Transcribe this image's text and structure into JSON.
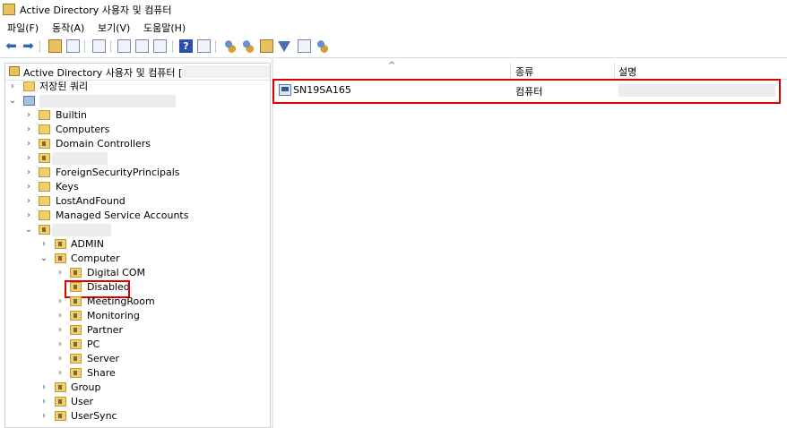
{
  "window": {
    "title": "Active Directory 사용자 및 컴퓨터"
  },
  "menu": [
    "파일(F)",
    "동작(A)",
    "보기(V)",
    "도움말(H)"
  ],
  "toolbar": {
    "icons": [
      "back-arrow-icon",
      "forward-arrow-icon",
      "up-folder-icon",
      "show-hide-tree-icon",
      "copy-icon",
      "properties-icon",
      "refresh-icon",
      "export-list-icon",
      "help-icon",
      "mmc-view-icon",
      "new-user-icon",
      "new-group-icon",
      "new-ou-icon",
      "filter-icon",
      "find-icon",
      "add-to-group-icon"
    ]
  },
  "tree": {
    "header": "Active Directory 사용자 및 컴퓨터 [",
    "saved_queries": "저장된 쿼리",
    "domain1_children": [
      "Builtin",
      "Computers",
      "Domain Controllers",
      "",
      "ForeignSecurityPrincipals",
      "Keys",
      "LostAndFound",
      "Managed Service Accounts"
    ],
    "ou": {
      "admin": "ADMIN",
      "computer": "Computer",
      "computer_children": [
        "Digital COM",
        "Disabled",
        "MeetingRoom",
        "Monitoring",
        "Partner",
        "PC",
        "Server",
        "Share"
      ],
      "after": [
        "Group",
        "User",
        "UserSync"
      ]
    }
  },
  "list": {
    "columns": {
      "name": "",
      "type": "종류",
      "desc": "설명"
    },
    "rows": [
      {
        "name": "SN19SA165",
        "type": "컴퓨터",
        "desc": ""
      }
    ]
  },
  "colors": {
    "highlight": "#e00000",
    "folder": "#f2cf6e"
  }
}
